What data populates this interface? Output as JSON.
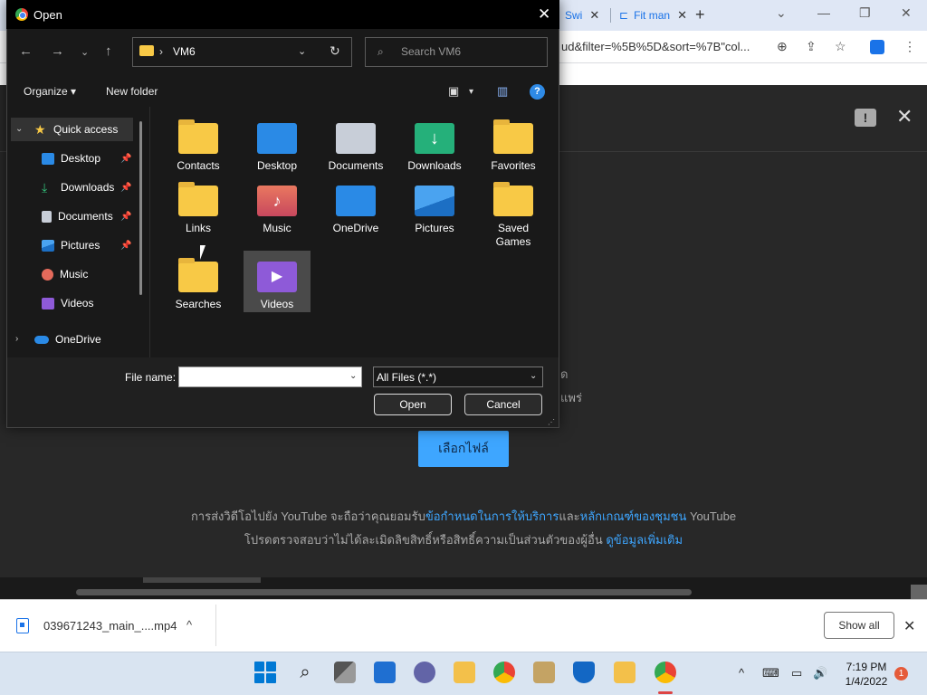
{
  "browser": {
    "tabs": [
      {
        "label": "Swi",
        "close": "✕"
      },
      {
        "label": "Fit man",
        "close": "✕"
      }
    ],
    "new_tab": "+",
    "controls": {
      "dropdown": "⌄",
      "minimize": "—",
      "restore": "❐",
      "close": "✕"
    },
    "url": "ud&filter=%5B%5D&sort=%7B\"col...",
    "accent": "#1a73e8"
  },
  "youtube": {
    "close": "✕",
    "feedback": "!",
    "hidden_line_1": "ด",
    "hidden_line_2": "แพร่",
    "select_files_button": "เลือกไฟล์",
    "terms_line_1_prefix": "การส่งวิดีโอไปยัง YouTube จะถือว่าคุณยอมรับ",
    "terms_link_1": "ข้อกำหนดในการให้บริการ",
    "terms_and": "และ",
    "terms_link_2": "หลักเกณฑ์ของชุมชน",
    "terms_line_1_suffix": " YouTube",
    "terms_line_2_prefix": "โปรดตรวจสอบว่าไม่ได้ละเมิดลิขสิทธิ์หรือสิทธิ์ความเป็นส่วนตัวของผู้อื่น ",
    "terms_link_3": "ดูข้อมูลเพิ่มเติม",
    "button_color": "#3ea6ff"
  },
  "download_bar": {
    "file_name": "039671243_main_....mp4",
    "show_all": "Show all",
    "close": "✕",
    "chevron": "^"
  },
  "taskbar": {
    "time": "7:19 PM",
    "date": "1/4/2022",
    "notification_count": "1",
    "tray_chevron": "^"
  },
  "dialog": {
    "title": "Open",
    "close": "✕",
    "path": "VM6",
    "path_separator": "›",
    "search_placeholder": "Search VM6",
    "organize": "Organize ▾",
    "new_folder": "New folder",
    "help": "?",
    "nav_items": [
      {
        "label": "Quick access",
        "pinned": false
      },
      {
        "label": "Desktop",
        "pinned": true
      },
      {
        "label": "Downloads",
        "pinned": true
      },
      {
        "label": "Documents",
        "pinned": true
      },
      {
        "label": "Pictures",
        "pinned": true
      },
      {
        "label": "Music",
        "pinned": false
      },
      {
        "label": "Videos",
        "pinned": false
      },
      {
        "label": "OneDrive",
        "pinned": false
      }
    ],
    "folders": [
      {
        "label": "Contacts",
        "icon": "contacts-folder-icon"
      },
      {
        "label": "Desktop",
        "icon": "desktop-folder-icon"
      },
      {
        "label": "Documents",
        "icon": "documents-folder-icon"
      },
      {
        "label": "Downloads",
        "icon": "downloads-folder-icon"
      },
      {
        "label": "Favorites",
        "icon": "favorites-folder-icon"
      },
      {
        "label": "Links",
        "icon": "links-folder-icon"
      },
      {
        "label": "Music",
        "icon": "music-folder-icon"
      },
      {
        "label": "OneDrive",
        "icon": "onedrive-folder-icon"
      },
      {
        "label": "Pictures",
        "icon": "pictures-folder-icon"
      },
      {
        "label": "Saved Games",
        "icon": "saved-games-folder-icon"
      },
      {
        "label": "Searches",
        "icon": "searches-folder-icon"
      },
      {
        "label": "Videos",
        "icon": "videos-folder-icon",
        "selected": true
      }
    ],
    "file_name_label": "File name:",
    "file_name_value": "",
    "file_type": "All Files (*.*)",
    "open_button": "Open",
    "cancel_button": "Cancel"
  }
}
